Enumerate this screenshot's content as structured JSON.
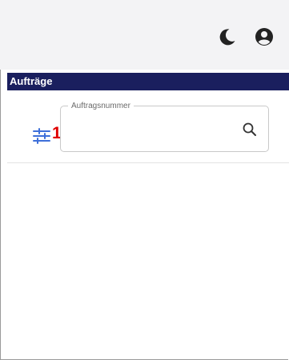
{
  "header": {
    "icons": {
      "theme_toggle": "moon-icon",
      "account": "user-circle-icon"
    }
  },
  "section": {
    "title": "Aufträge",
    "bar_color": "#1a1f5e"
  },
  "filter": {
    "filter_toggle_icon": "sliders-icon",
    "step_marker": "1.",
    "step_marker_color": "#e00000",
    "order_number_field": {
      "label": "Auftragsnummer",
      "value": "",
      "search_icon": "search-icon"
    }
  }
}
